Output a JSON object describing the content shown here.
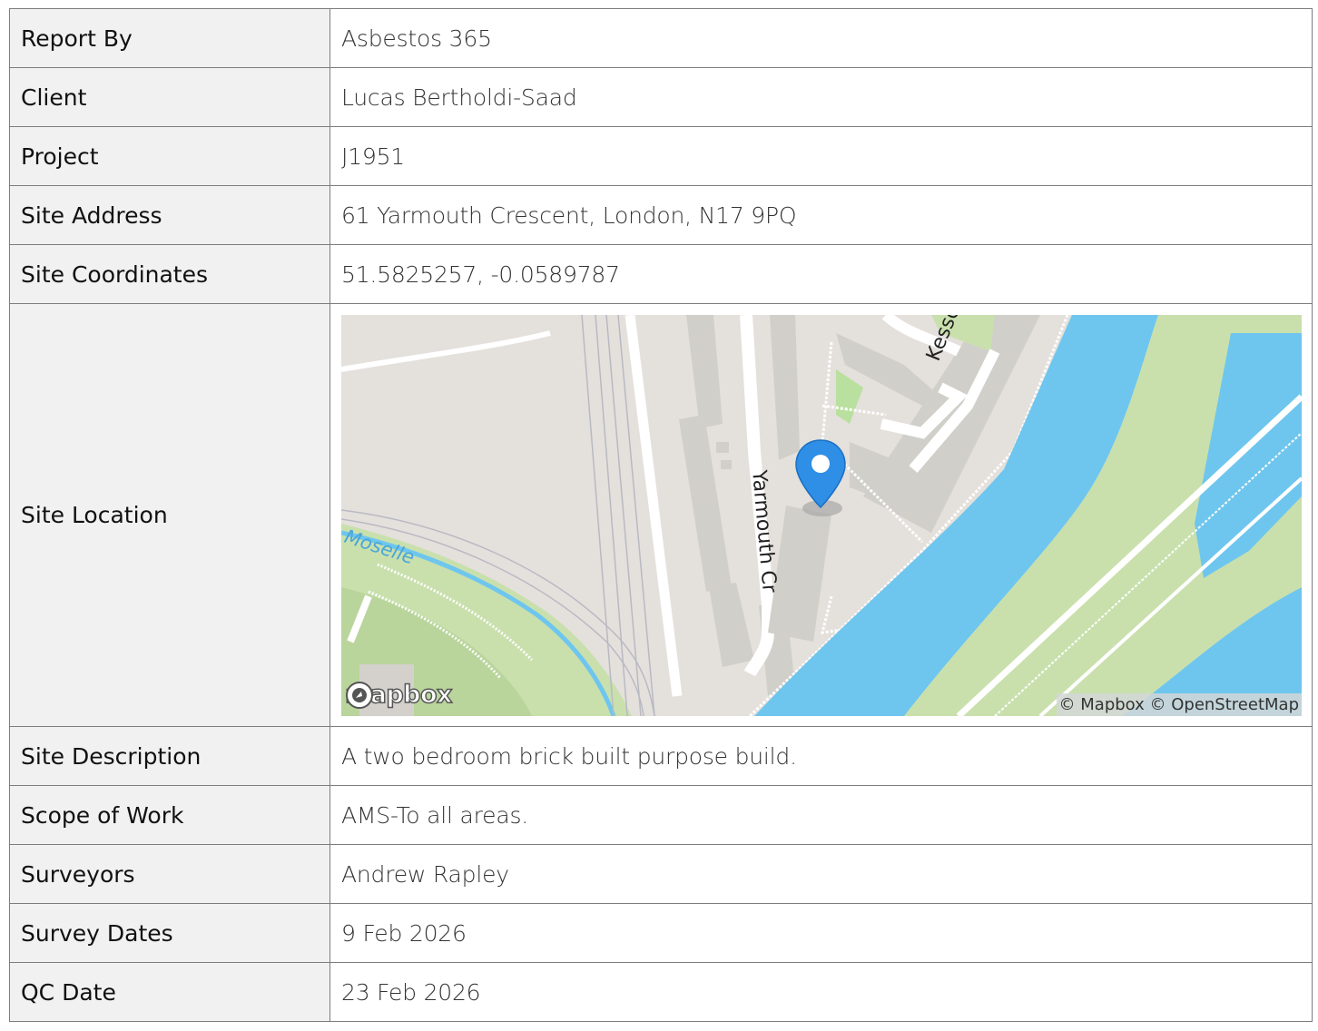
{
  "rows": [
    {
      "label": "Report By",
      "value": "Asbestos 365"
    },
    {
      "label": "Client",
      "value": "Lucas Bertholdi-Saad"
    },
    {
      "label": "Project",
      "value": "J1951"
    },
    {
      "label": "Site Address",
      "value": "61 Yarmouth Crescent, London, N17 9PQ"
    },
    {
      "label": "Site Coordinates",
      "value": "51.5825257, -0.0589787"
    },
    {
      "label": "Site Location"
    },
    {
      "label": "Site Description",
      "value": "A two bedroom brick built purpose build."
    },
    {
      "label": "Scope of Work",
      "value": "AMS-To all areas."
    },
    {
      "label": "Surveyors",
      "value": "Andrew Rapley"
    },
    {
      "label": "Survey Dates",
      "value": "9 Feb 2026"
    },
    {
      "label": "QC Date",
      "value": "23 Feb 2026"
    }
  ],
  "map": {
    "street_labels": [
      "Kessock C",
      "Yarmouth Cr"
    ],
    "water_label": "Moselle",
    "logo_text": "mapbox",
    "attribution": "© Mapbox © OpenStreetMap",
    "colors": {
      "land": "#e4e0dc",
      "water": "#6ec6ee",
      "park": "#c9e0ad",
      "building": "#d0cfca",
      "pin": "#2f8ee5"
    }
  }
}
